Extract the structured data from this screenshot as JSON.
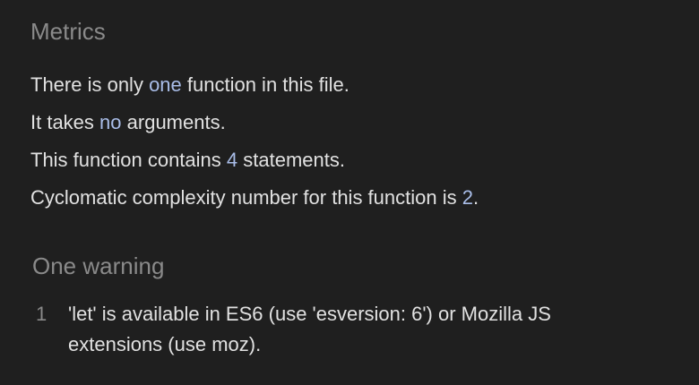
{
  "metrics": {
    "title": "Metrics",
    "line1": {
      "pre": "There is only ",
      "hl": "one",
      "post": " function in this file."
    },
    "line2": {
      "pre": "It takes ",
      "hl": "no",
      "post": " arguments."
    },
    "line3": {
      "pre": "This function contains ",
      "hl": "4",
      "post": " statements."
    },
    "line4": {
      "pre": "Cyclomatic complexity number for this function is ",
      "hl": "2",
      "post": "."
    }
  },
  "warnings": {
    "title": "One warning",
    "items": [
      {
        "line": "1",
        "message_line1": "'let' is available in ES6 (use 'esversion: 6') or Mozilla JS",
        "message_line2": "extensions (use moz)."
      }
    ]
  },
  "colors": {
    "background": "#1f1f1f",
    "text": "#e1e1e1",
    "heading": "#8a8a8a",
    "highlight": "#a9bde8"
  }
}
